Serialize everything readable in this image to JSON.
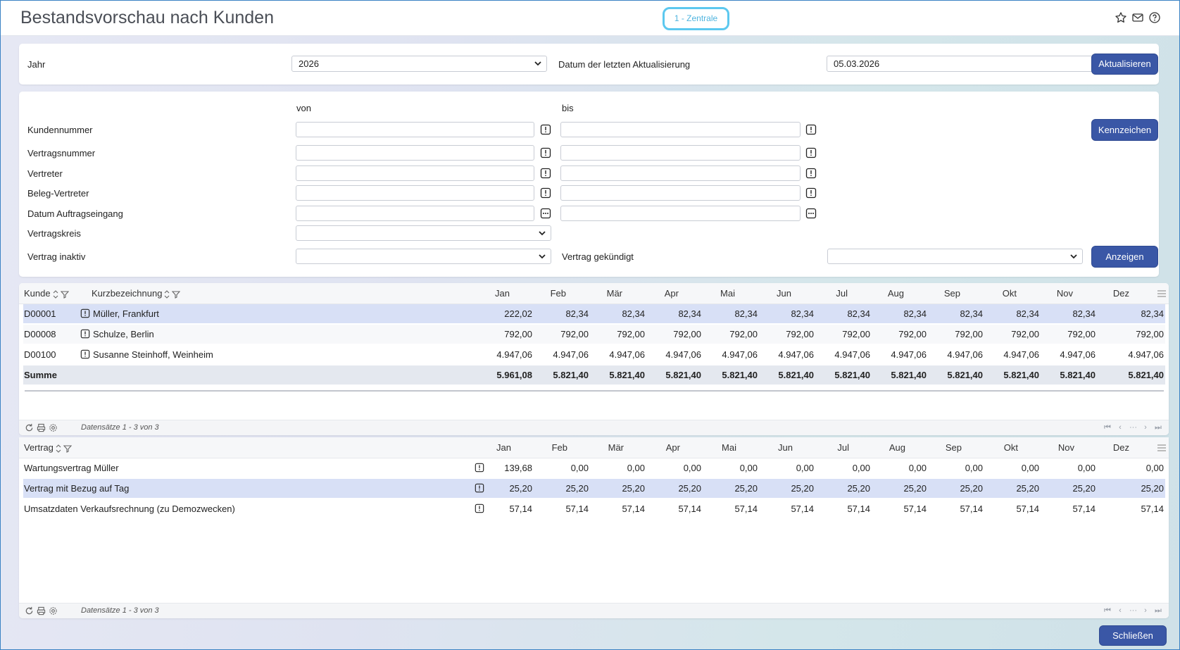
{
  "header": {
    "title": "Bestandsvorschau nach Kunden",
    "badge": "1 - Zentrale",
    "icons": [
      "star-icon",
      "mail-icon",
      "help-icon"
    ]
  },
  "year_panel": {
    "year_label": "Jahr",
    "year_value": "2026",
    "update_label": "Datum der letzten Aktualisierung",
    "update_value": "05.03.2026",
    "update_button": "Aktualisieren"
  },
  "filters": {
    "von": "von",
    "bis": "bis",
    "kundennummer": "Kundennummer",
    "vertragsnummer": "Vertragsnummer",
    "vertreter": "Vertreter",
    "beleg_vertreter": "Beleg-Vertreter",
    "datum_auftragseingang": "Datum Auftragseingang",
    "vertragskreis": "Vertragskreis",
    "vertrag_inaktiv": "Vertrag inaktiv",
    "vertrag_gekuendigt": "Vertrag gekündigt",
    "kennzeichen_button": "Kennzeichen",
    "anzeigen_button": "Anzeigen"
  },
  "months": [
    "Jan",
    "Feb",
    "Mär",
    "Apr",
    "Mai",
    "Jun",
    "Jul",
    "Aug",
    "Sep",
    "Okt",
    "Nov",
    "Dez"
  ],
  "customer_grid": {
    "col_kunde": "Kunde",
    "col_kurz": "Kurzbezeichnung",
    "rows": [
      {
        "kunde": "D00001",
        "name": "Müller, Frankfurt",
        "values": [
          "222,02",
          "82,34",
          "82,34",
          "82,34",
          "82,34",
          "82,34",
          "82,34",
          "82,34",
          "82,34",
          "82,34",
          "82,34",
          "82,34"
        ]
      },
      {
        "kunde": "D00008",
        "name": "Schulze, Berlin",
        "values": [
          "792,00",
          "792,00",
          "792,00",
          "792,00",
          "792,00",
          "792,00",
          "792,00",
          "792,00",
          "792,00",
          "792,00",
          "792,00",
          "792,00"
        ]
      },
      {
        "kunde": "D00100",
        "name": "Susanne Steinhoff, Weinheim",
        "values": [
          "4.947,06",
          "4.947,06",
          "4.947,06",
          "4.947,06",
          "4.947,06",
          "4.947,06",
          "4.947,06",
          "4.947,06",
          "4.947,06",
          "4.947,06",
          "4.947,06",
          "4.947,06"
        ]
      }
    ],
    "sum_label": "Summe",
    "sum_values": [
      "5.961,08",
      "5.821,40",
      "5.821,40",
      "5.821,40",
      "5.821,40",
      "5.821,40",
      "5.821,40",
      "5.821,40",
      "5.821,40",
      "5.821,40",
      "5.821,40",
      "5.821,40"
    ],
    "records": "Datensätze 1 - 3 von 3"
  },
  "contract_grid": {
    "col_vertrag": "Vertrag",
    "rows": [
      {
        "name": "Wartungsvertrag Müller",
        "values": [
          "139,68",
          "0,00",
          "0,00",
          "0,00",
          "0,00",
          "0,00",
          "0,00",
          "0,00",
          "0,00",
          "0,00",
          "0,00",
          "0,00"
        ]
      },
      {
        "name": "Vertrag mit Bezug auf Tag",
        "values": [
          "25,20",
          "25,20",
          "25,20",
          "25,20",
          "25,20",
          "25,20",
          "25,20",
          "25,20",
          "25,20",
          "25,20",
          "25,20",
          "25,20"
        ]
      },
      {
        "name": "Umsatzdaten Verkaufsrechnung (zu Demozwecken)",
        "values": [
          "57,14",
          "57,14",
          "57,14",
          "57,14",
          "57,14",
          "57,14",
          "57,14",
          "57,14",
          "57,14",
          "57,14",
          "57,14",
          "57,14"
        ]
      }
    ],
    "records": "Datensätze 1 - 3 von 3"
  },
  "close_button": "Schließen"
}
